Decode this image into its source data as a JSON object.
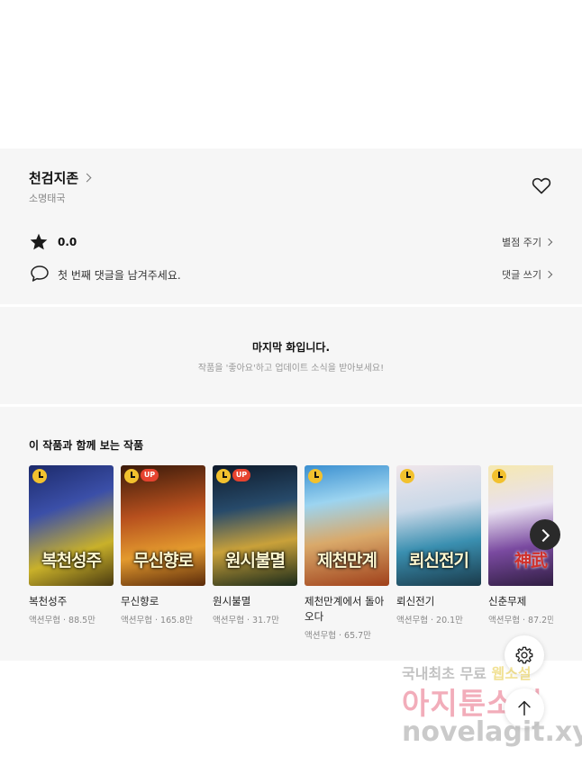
{
  "work": {
    "title": "천검지존",
    "author": "소명태국",
    "rating": "0.0",
    "rate_link": "별점 주기",
    "comment_prompt": "첫 번째 댓글을 남겨주세요.",
    "comment_link": "댓글 쓰기"
  },
  "end_notice": {
    "title": "마지막 화입니다.",
    "subtitle": "작품을 '좋아요'하고 업데이트 소식을 받아보세요!"
  },
  "recommendations": {
    "heading": "이 작품과 함께 보는 작품",
    "items": [
      {
        "name": "복천성주",
        "meta": "액션무협 · 88.5만",
        "cover_text": "복천성주",
        "up": false
      },
      {
        "name": "무신향로",
        "meta": "액션무협 · 165.8만",
        "cover_text": "무신향로",
        "up": true
      },
      {
        "name": "원시불멸",
        "meta": "액션무협 · 31.7만",
        "cover_text": "원시불멸",
        "up": true
      },
      {
        "name": "제천만계에서 돌아오다",
        "meta": "액션무협 · 65.7만",
        "cover_text": "제천만계",
        "up": false
      },
      {
        "name": "뢰신전기",
        "meta": "액션무협 · 20.1만",
        "cover_text": "뢰신전기",
        "up": false
      },
      {
        "name": "신춘무제",
        "meta": "액션무협 · 87.2만",
        "cover_text": "神武",
        "up": false
      }
    ]
  },
  "watermark": {
    "line1_a": "국내최초 무료 ",
    "line1_b": "웹소설",
    "line2": "아지툰소설",
    "line3": "novelagit.xyz"
  },
  "icons": {
    "like": "heart-icon",
    "star": "star-icon",
    "comment": "speech-bubble-icon",
    "next": "chevron-right-icon",
    "settings": "gear-icon",
    "scroll_top": "arrow-up-icon",
    "free_badge": "clock-icon"
  }
}
